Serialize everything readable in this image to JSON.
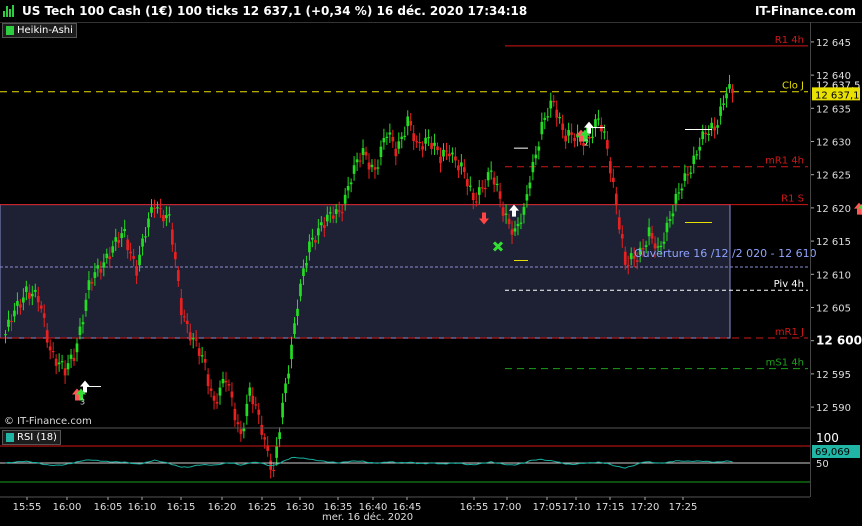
{
  "header": {
    "title": "US Tech 100 Cash (1€) 100 ticks 12 637,1 (+0,34 %) 16 déc. 2020 17:34:18",
    "brand": "IT-Finance.com"
  },
  "indicator_tag": "Heikin-Ashi",
  "rsi_tag": "RSI (18)",
  "copyright": "© IT-Finance.com",
  "date_label": "mer. 16 déc. 2020",
  "colors": {
    "bull": "#22dd22",
    "bear": "#e82020",
    "resistance": "#d01818",
    "pivot": "#ffffff",
    "support": "#1aa01a",
    "close_line": "#e8e000",
    "price_badge": "#e8e000",
    "zone_fill": "#1e2033",
    "zone_border": "#8a8fcf",
    "rsi_line": "#18b0a0",
    "rsi_badge": "#20b5a5"
  },
  "chart_data": {
    "type": "candlestick",
    "subtype": "heikin-ashi",
    "ylim": [
      12587,
      12648
    ],
    "yticks": [
      "12 645",
      "12 640",
      "12 635",
      "12 630",
      "12 625",
      "12 620",
      "12 615",
      "12 610",
      "12 605",
      "12 600",
      "12 595",
      "12 590"
    ],
    "ytick_values": [
      12645,
      12640,
      12635,
      12630,
      12625,
      12620,
      12615,
      12610,
      12605,
      12600,
      12595,
      12590
    ],
    "ytick_bold": "12 600",
    "xticks": [
      "15:55",
      "16:00",
      "16:05",
      "16:10",
      "16:15",
      "16:20",
      "16:25",
      "16:30",
      "16:35",
      "16:40",
      "16:45",
      "16:55",
      "17:00",
      "17:05",
      "17:10",
      "17:15",
      "17:20",
      "17:25"
    ],
    "last_price": 12637.1,
    "last_price_label": "12 637,1",
    "candle_count": 245,
    "path_points": [
      [
        0,
        12601
      ],
      [
        3,
        12604
      ],
      [
        7,
        12608
      ],
      [
        11,
        12606
      ],
      [
        15,
        12599
      ],
      [
        20,
        12595
      ],
      [
        23,
        12598
      ],
      [
        28,
        12608
      ],
      [
        34,
        12613
      ],
      [
        40,
        12616
      ],
      [
        44,
        12611
      ],
      [
        50,
        12621
      ],
      [
        55,
        12618
      ],
      [
        59,
        12605
      ],
      [
        63,
        12600
      ],
      [
        67,
        12596
      ],
      [
        70,
        12591
      ],
      [
        74,
        12594
      ],
      [
        79,
        12586
      ],
      [
        82,
        12592
      ],
      [
        86,
        12587
      ],
      [
        90,
        12580
      ],
      [
        94,
        12593
      ],
      [
        98,
        12606
      ],
      [
        102,
        12614
      ],
      [
        106,
        12618
      ],
      [
        112,
        12619
      ],
      [
        116,
        12625
      ],
      [
        120,
        12628
      ],
      [
        124,
        12626
      ],
      [
        128,
        12631
      ],
      [
        131,
        12629
      ],
      [
        135,
        12633
      ],
      [
        138,
        12629
      ],
      [
        142,
        12631
      ],
      [
        146,
        12627
      ],
      [
        149,
        12629
      ],
      [
        153,
        12626
      ],
      [
        157,
        12621
      ],
      [
        159,
        12623
      ],
      [
        163,
        12625
      ],
      [
        167,
        12620
      ],
      [
        171,
        12616
      ],
      [
        174,
        12619
      ],
      [
        176,
        12625
      ],
      [
        180,
        12632
      ],
      [
        184,
        12636
      ],
      [
        188,
        12631
      ],
      [
        192,
        12630
      ],
      [
        196,
        12631
      ],
      [
        199,
        12633
      ],
      [
        202,
        12629
      ],
      [
        205,
        12621
      ],
      [
        208,
        12611
      ],
      [
        212,
        12613
      ],
      [
        216,
        12616
      ],
      [
        219,
        12613
      ],
      [
        223,
        12619
      ],
      [
        228,
        12624
      ],
      [
        233,
        12630
      ],
      [
        238,
        12632
      ],
      [
        242,
        12638
      ],
      [
        244,
        12637
      ]
    ],
    "levels": [
      {
        "label": "R1 4h",
        "value": 12644.4,
        "style": "solid",
        "color": "resistance",
        "from": "17:00"
      },
      {
        "label": "Clo J",
        "value": 12637.5,
        "style": "dashed",
        "color": "close_line",
        "from": "start"
      },
      {
        "label": "mR1 4h",
        "value": 12626.2,
        "style": "dashed",
        "color": "resistance",
        "from": "17:00"
      },
      {
        "label": "R1 S",
        "value": 12620.5,
        "style": "solid",
        "color": "resistance",
        "from": "start"
      },
      {
        "label": "Piv 4h",
        "value": 12607.6,
        "style": "dashed",
        "color": "pivot",
        "from": "17:00"
      },
      {
        "label": "mR1 J",
        "value": 12600.4,
        "style": "dashed",
        "color": "resistance",
        "from": "start"
      },
      {
        "label": "mS1 4h",
        "value": 12595.8,
        "style": "dashed",
        "color": "support",
        "from": "17:00"
      }
    ],
    "axis_value_labels": [
      "12 637,5"
    ],
    "ouverture_label": "Ouverture 16 /12 /2 020  - 12 610",
    "ouverture_value": 12611.1,
    "zone": {
      "from_price": 12620.5,
      "to_price": 12600.4
    },
    "signals": [
      {
        "kind": "arrows-up",
        "near": "16:00",
        "count_label": "3"
      },
      {
        "kind": "arrow-down",
        "near": "16:55"
      },
      {
        "kind": "cross",
        "near": "16:55"
      },
      {
        "kind": "arrows-up",
        "near": "17:05",
        "count_label": "2"
      },
      {
        "kind": "arrows-up",
        "near": "17:25",
        "count_label": "2"
      }
    ],
    "rsi": {
      "label": "RSI (18)",
      "yticks": [
        "100",
        "50"
      ],
      "value": 69.069,
      "value_label": "69,069"
    }
  }
}
